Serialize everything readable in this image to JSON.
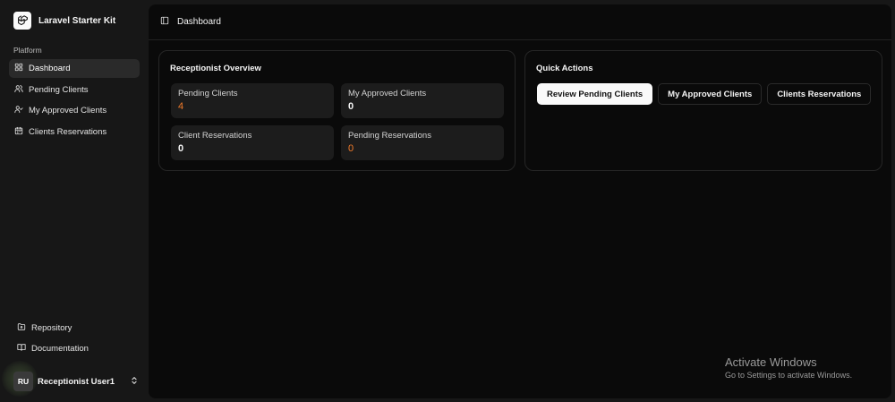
{
  "app": {
    "title": "Laravel Starter Kit"
  },
  "sidebar": {
    "section_label": "Platform",
    "items": [
      {
        "label": "Dashboard",
        "icon": "layout-grid-icon",
        "active": true
      },
      {
        "label": "Pending Clients",
        "icon": "users-icon",
        "active": false
      },
      {
        "label": "My Approved Clients",
        "icon": "user-check-icon",
        "active": false
      },
      {
        "label": "Clients Reservations",
        "icon": "calendar-icon",
        "active": false
      }
    ],
    "footer_links": [
      {
        "label": "Repository",
        "icon": "folder-git-icon"
      },
      {
        "label": "Documentation",
        "icon": "book-open-icon"
      }
    ],
    "user": {
      "initials": "RU",
      "name": "Receptionist User1"
    }
  },
  "header": {
    "title": "Dashboard",
    "toggle_icon": "panel-left-icon"
  },
  "overview": {
    "title": "Receptionist Overview",
    "stats": [
      {
        "label": "Pending Clients",
        "value": "4",
        "color": "#f07a2a"
      },
      {
        "label": "My Approved Clients",
        "value": "0",
        "color": "#f5f5f5"
      },
      {
        "label": "Client Reservations",
        "value": "0",
        "color": "#f5f5f5"
      },
      {
        "label": "Pending Reservations",
        "value": "0",
        "color": "#f07a2a"
      }
    ]
  },
  "quick_actions": {
    "title": "Quick Actions",
    "buttons": [
      {
        "label": "Review Pending Clients",
        "primary": true
      },
      {
        "label": "My Approved Clients",
        "primary": false
      },
      {
        "label": "Clients Reservations",
        "primary": false
      }
    ]
  },
  "watermark": {
    "title": "Activate Windows",
    "subtitle": "Go to Settings to activate Windows."
  },
  "colors": {
    "accent": "#f07a2a",
    "background": "#0a0a0a",
    "sidebar": "#171717"
  }
}
